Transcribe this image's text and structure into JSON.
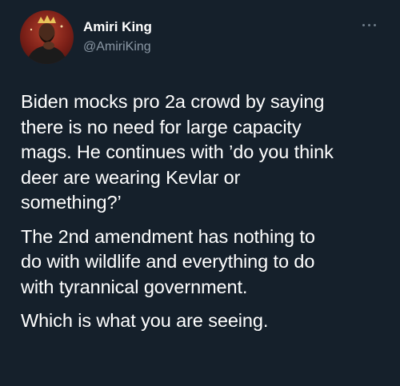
{
  "author": {
    "display_name": "Amiri King",
    "handle": "@AmiriKing"
  },
  "menu_icon": "more-horizontal-icon",
  "tweet": {
    "paragraphs": [
      "Biden mocks pro 2a crowd by saying\nthere is no need for large capacity\nmags. He continues with ’do you think\ndeer are wearing Kevlar or\nsomething?’",
      "The 2nd amendment has nothing to\ndo with wildlife and everything to do\nwith tyrannical government.",
      "Which is what you are seeing."
    ]
  },
  "colors": {
    "background": "#15202b",
    "text": "#ffffff",
    "secondary_text": "#8b98a5"
  }
}
